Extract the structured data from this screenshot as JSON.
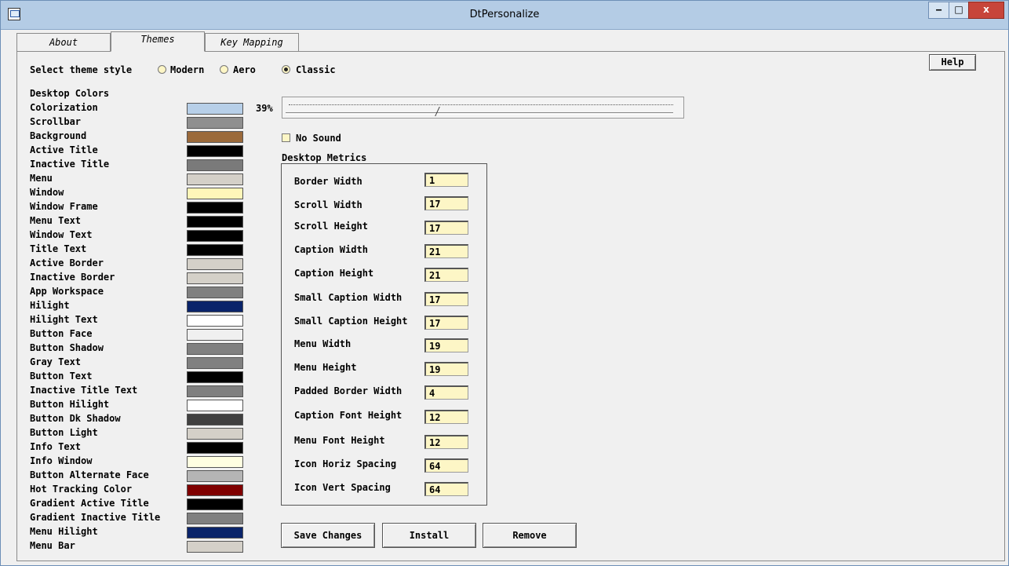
{
  "window": {
    "title": "DtPersonalize"
  },
  "tabs": [
    "About",
    "Themes",
    "Key Mapping"
  ],
  "help_label": "Help",
  "theme": {
    "label": "Select theme style",
    "options": [
      "Modern",
      "Aero",
      "Classic"
    ],
    "selected": "Classic"
  },
  "desktop_colors": {
    "heading": "Desktop Colors",
    "items": [
      {
        "label": "Colorization",
        "color": "#b7cfe8"
      },
      {
        "label": "Scrollbar",
        "color": "#8f8f8f"
      },
      {
        "label": "Background",
        "color": "#9b6a3b"
      },
      {
        "label": "Active Title",
        "color": "#000000"
      },
      {
        "label": "Inactive Title",
        "color": "#7a7a7a"
      },
      {
        "label": "Menu",
        "color": "#d4d0c8"
      },
      {
        "label": "Window",
        "color": "#fff6b9"
      },
      {
        "label": "Window Frame",
        "color": "#000000"
      },
      {
        "label": "Menu Text",
        "color": "#000000"
      },
      {
        "label": "Window Text",
        "color": "#000000"
      },
      {
        "label": "Title Text",
        "color": "#000000"
      },
      {
        "label": "Active Border",
        "color": "#d4d0c8"
      },
      {
        "label": "Inactive Border",
        "color": "#d4d0c8"
      },
      {
        "label": "App Workspace",
        "color": "#808080"
      },
      {
        "label": "Hilight",
        "color": "#0a246a"
      },
      {
        "label": "Hilight Text",
        "color": "#ffffff"
      },
      {
        "label": "Button Face",
        "color": "#f0f0f0"
      },
      {
        "label": "Button Shadow",
        "color": "#808080"
      },
      {
        "label": "Gray Text",
        "color": "#808080"
      },
      {
        "label": "Button Text",
        "color": "#000000"
      },
      {
        "label": "Inactive Title Text",
        "color": "#808080"
      },
      {
        "label": "Button Hilight",
        "color": "#ffffff"
      },
      {
        "label": "Button Dk Shadow",
        "color": "#404040"
      },
      {
        "label": "Button Light",
        "color": "#d4d0c8"
      },
      {
        "label": "Info Text",
        "color": "#000000"
      },
      {
        "label": "Info Window",
        "color": "#ffffe1"
      },
      {
        "label": "Button Alternate Face",
        "color": "#b5b5b5"
      },
      {
        "label": "Hot Tracking Color",
        "color": "#800000"
      },
      {
        "label": "Gradient Active Title",
        "color": "#000000"
      },
      {
        "label": "Gradient Inactive Title",
        "color": "#808080"
      },
      {
        "label": "Menu Hilight",
        "color": "#0a246a"
      },
      {
        "label": "Menu Bar",
        "color": "#d4d0c8"
      }
    ]
  },
  "colorization": {
    "percent_label": "39%",
    "value": 0.39
  },
  "no_sound_label": "No Sound",
  "desktop_metrics": {
    "heading": "Desktop Metrics",
    "items": [
      {
        "label": "Border Width",
        "value": "1"
      },
      {
        "label": "Scroll Width",
        "value": "17"
      },
      {
        "label": "Scroll Height",
        "value": "17"
      },
      {
        "label": "Caption Width",
        "value": "21"
      },
      {
        "label": "Caption Height",
        "value": "21"
      },
      {
        "label": "Small Caption Width",
        "value": "17"
      },
      {
        "label": "Small Caption Height",
        "value": "17"
      },
      {
        "label": "Menu Width",
        "value": "19"
      },
      {
        "label": "Menu Height",
        "value": "19"
      },
      {
        "label": "Padded Border Width",
        "value": "4"
      },
      {
        "label": "Caption Font Height",
        "value": "12"
      },
      {
        "label": "Menu Font Height",
        "value": "12"
      },
      {
        "label": "Icon Horiz Spacing",
        "value": "64"
      },
      {
        "label": "Icon Vert Spacing",
        "value": "64"
      }
    ]
  },
  "buttons": {
    "save": "Save Changes",
    "install": "Install",
    "remove": "Remove"
  }
}
